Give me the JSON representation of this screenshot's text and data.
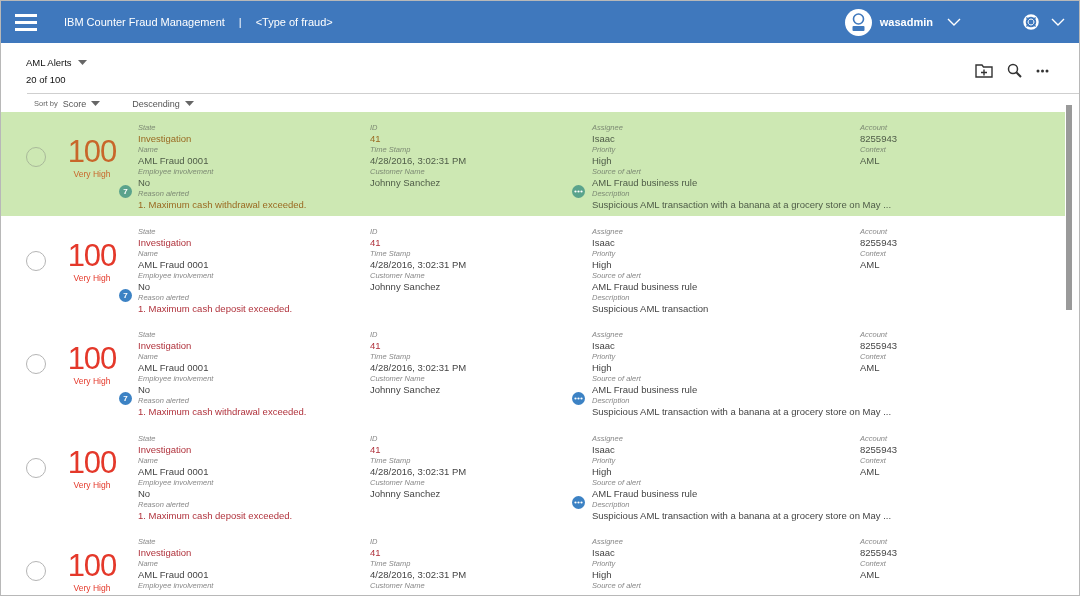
{
  "header": {
    "app_title": "IBM Counter Fraud Management",
    "separator": "|",
    "context": "<Type of fraud>",
    "user": "wasadmin"
  },
  "list_header": {
    "title": "AML Alerts",
    "count": "20 of 100"
  },
  "sort": {
    "label": "Sort by",
    "field": "Score",
    "order": "Descending"
  },
  "alerts": [
    {
      "selected": true,
      "score": "100",
      "rating": "Very High",
      "columns": [
        [
          {
            "label": "State",
            "value": "Investigation",
            "alert": true
          },
          {
            "label": "Name",
            "value": "AML Fraud 0001",
            "alert": false
          },
          {
            "label": "Employee involvement",
            "value": "No",
            "alert": false
          },
          {
            "label": "Reason alerted",
            "value": "1. Maximum cash withdrawal exceeded.",
            "alert": true,
            "badge": "7"
          }
        ],
        [
          {
            "label": "ID",
            "value": "41",
            "alert": true
          },
          {
            "label": "Time Stamp",
            "value": "4/28/2016, 3:02:31 PM",
            "alert": false
          },
          {
            "label": "Customer Name",
            "value": "Johnny Sanchez",
            "alert": false
          }
        ],
        [
          {
            "label": "Assignee",
            "value": "Isaac",
            "alert": false
          },
          {
            "label": "Priority",
            "value": "High",
            "alert": false
          },
          {
            "label": "Source of alert",
            "value": "AML Fraud business rule",
            "alert": false
          },
          {
            "label": "Description",
            "value": "Suspicious AML transaction with a banana at a grocery store on May ...",
            "alert": false,
            "more": true
          }
        ],
        [
          {
            "label": "Account",
            "value": "8255943",
            "alert": false
          },
          {
            "label": "Context",
            "value": "AML",
            "alert": false
          }
        ]
      ]
    },
    {
      "selected": false,
      "score": "100",
      "rating": "Very High",
      "columns": [
        [
          {
            "label": "State",
            "value": "Investigation",
            "alert": true
          },
          {
            "label": "Name",
            "value": "AML Fraud 0001",
            "alert": false
          },
          {
            "label": "Employee involvement",
            "value": "No",
            "alert": false
          },
          {
            "label": "Reason alerted",
            "value": "1. Maximum cash deposit exceeded.",
            "alert": true,
            "badge": "7"
          }
        ],
        [
          {
            "label": "ID",
            "value": "41",
            "alert": true
          },
          {
            "label": "Time Stamp",
            "value": "4/28/2016, 3:02:31 PM",
            "alert": false
          },
          {
            "label": "Customer Name",
            "value": "Johnny Sanchez",
            "alert": false
          }
        ],
        [
          {
            "label": "Assignee",
            "value": "Isaac",
            "alert": false
          },
          {
            "label": "Priority",
            "value": "High",
            "alert": false
          },
          {
            "label": "Source of alert",
            "value": "AML Fraud business rule",
            "alert": false
          },
          {
            "label": "Description",
            "value": "Suspicious AML transaction",
            "alert": false,
            "more": false
          }
        ],
        [
          {
            "label": "Account",
            "value": "8255943",
            "alert": false
          },
          {
            "label": "Context",
            "value": "AML",
            "alert": false
          }
        ]
      ]
    },
    {
      "selected": false,
      "score": "100",
      "rating": "Very High",
      "columns": [
        [
          {
            "label": "State",
            "value": "Investigation",
            "alert": true
          },
          {
            "label": "Name",
            "value": "AML Fraud 0001",
            "alert": false
          },
          {
            "label": "Employee involvement",
            "value": "No",
            "alert": false
          },
          {
            "label": "Reason alerted",
            "value": "1. Maximum cash withdrawal exceeded.",
            "alert": true,
            "badge": "7"
          }
        ],
        [
          {
            "label": "ID",
            "value": "41",
            "alert": true
          },
          {
            "label": "Time Stamp",
            "value": "4/28/2016, 3:02:31 PM",
            "alert": false
          },
          {
            "label": "Customer Name",
            "value": "Johnny Sanchez",
            "alert": false
          }
        ],
        [
          {
            "label": "Assignee",
            "value": "Isaac",
            "alert": false
          },
          {
            "label": "Priority",
            "value": "High",
            "alert": false
          },
          {
            "label": "Source of alert",
            "value": "AML Fraud business rule",
            "alert": false
          },
          {
            "label": "Description",
            "value": "Suspicious AML transaction with a banana at a grocery store on May ...",
            "alert": false,
            "more": true
          }
        ],
        [
          {
            "label": "Account",
            "value": "8255943",
            "alert": false
          },
          {
            "label": "Context",
            "value": "AML",
            "alert": false
          }
        ]
      ]
    },
    {
      "selected": false,
      "score": "100",
      "rating": "Very High",
      "columns": [
        [
          {
            "label": "State",
            "value": "Investigation",
            "alert": true
          },
          {
            "label": "Name",
            "value": "AML Fraud 0001",
            "alert": false
          },
          {
            "label": "Employee involvement",
            "value": "No",
            "alert": false
          },
          {
            "label": "Reason alerted",
            "value": "1. Maximum cash deposit exceeded.",
            "alert": true
          }
        ],
        [
          {
            "label": "ID",
            "value": "41",
            "alert": true
          },
          {
            "label": "Time Stamp",
            "value": "4/28/2016, 3:02:31 PM",
            "alert": false
          },
          {
            "label": "Customer Name",
            "value": "Johnny Sanchez",
            "alert": false
          }
        ],
        [
          {
            "label": "Assignee",
            "value": "Isaac",
            "alert": false
          },
          {
            "label": "Priority",
            "value": "High",
            "alert": false
          },
          {
            "label": "Source of alert",
            "value": "AML Fraud business rule",
            "alert": false
          },
          {
            "label": "Description",
            "value": "Suspicious AML transaction with a banana at a grocery store on May ...",
            "alert": false,
            "more": true
          }
        ],
        [
          {
            "label": "Account",
            "value": "8255943",
            "alert": false
          },
          {
            "label": "Context",
            "value": "AML",
            "alert": false
          }
        ]
      ]
    },
    {
      "selected": false,
      "score": "100",
      "rating": "Very High",
      "columns": [
        [
          {
            "label": "State",
            "value": "Investigation",
            "alert": true
          },
          {
            "label": "Name",
            "value": "AML Fraud 0001",
            "alert": false
          },
          {
            "label": "Employee involvement"
          }
        ],
        [
          {
            "label": "ID",
            "value": "41",
            "alert": true
          },
          {
            "label": "Time Stamp",
            "value": "4/28/2016, 3:02:31 PM",
            "alert": false
          },
          {
            "label": "Customer Name"
          }
        ],
        [
          {
            "label": "Assignee",
            "value": "Isaac",
            "alert": false
          },
          {
            "label": "Priority",
            "value": "High",
            "alert": false
          },
          {
            "label": "Source of alert"
          }
        ],
        [
          {
            "label": "Account",
            "value": "8255943",
            "alert": false
          },
          {
            "label": "Context",
            "value": "AML",
            "alert": false
          }
        ]
      ]
    }
  ]
}
